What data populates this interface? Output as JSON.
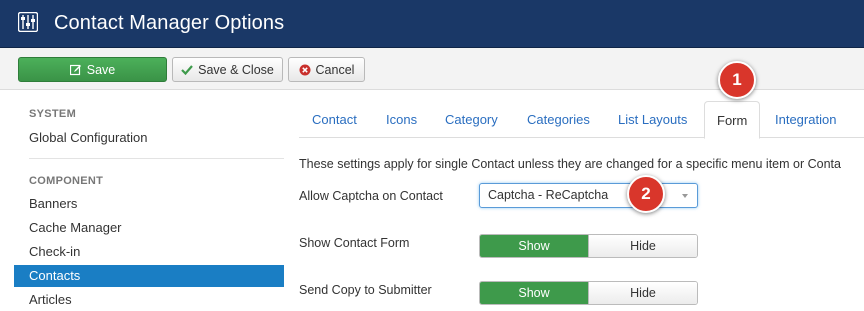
{
  "header": {
    "title": "Contact Manager Options",
    "app_icon": "options-sliders-icon"
  },
  "toolbar": {
    "save_label": "Save",
    "save_close_label": "Save & Close",
    "cancel_label": "Cancel"
  },
  "sidebar": {
    "system_heading": "SYSTEM",
    "system_items": [
      {
        "label": "Global Configuration"
      }
    ],
    "component_heading": "COMPONENT",
    "component_items": [
      {
        "label": "Banners"
      },
      {
        "label": "Cache Manager"
      },
      {
        "label": "Check-in"
      },
      {
        "label": "Contacts",
        "active": true
      },
      {
        "label": "Articles"
      }
    ]
  },
  "tabs": [
    {
      "label": "Contact"
    },
    {
      "label": "Icons"
    },
    {
      "label": "Category"
    },
    {
      "label": "Categories"
    },
    {
      "label": "List Layouts"
    },
    {
      "label": "Form",
      "active": true
    },
    {
      "label": "Integration"
    }
  ],
  "form": {
    "description": "These settings apply for single Contact unless they are changed for a specific menu item or Conta",
    "captcha": {
      "label": "Allow Captcha on Contact",
      "value": "Captcha - ReCaptcha"
    },
    "show_contact_form": {
      "label": "Show Contact Form",
      "on_label": "Show",
      "off_label": "Hide",
      "selected": "Show"
    },
    "send_copy": {
      "label": "Send Copy to Submitter",
      "on_label": "Show",
      "off_label": "Hide",
      "selected": "Show"
    }
  },
  "annotations": {
    "badge1": "1",
    "badge2": "2"
  },
  "colors": {
    "header_bg": "#1a3867",
    "save_green": "#3e9a4b",
    "active_sidebar": "#1a7ec4",
    "link_blue": "#2a6ec0",
    "badge_red": "#d9362b"
  }
}
